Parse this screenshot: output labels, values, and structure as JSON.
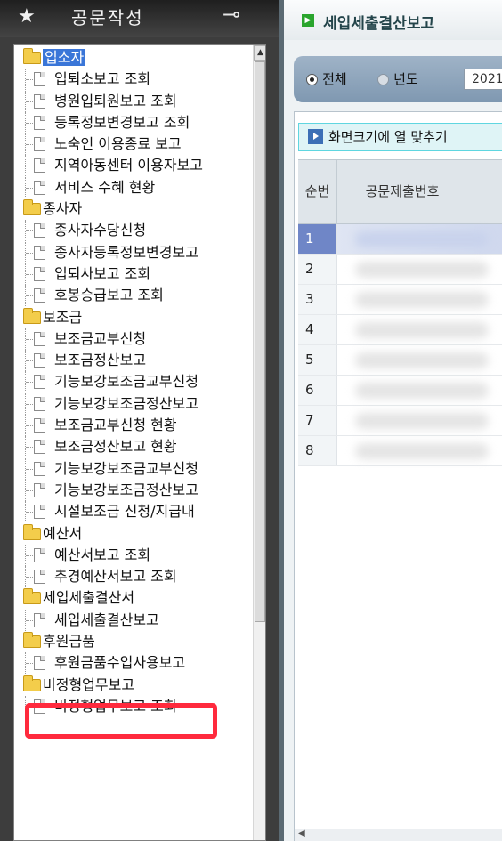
{
  "left_panel": {
    "title": "공문작성",
    "star_icon": "★",
    "pin_icon": "⊸"
  },
  "tree": [
    {
      "type": "folder",
      "label": "입소자",
      "selected": true
    },
    {
      "type": "item",
      "label": "입퇴소보고 조회"
    },
    {
      "type": "item",
      "label": "병원입퇴원보고 조회"
    },
    {
      "type": "item",
      "label": "등록정보변경보고 조회"
    },
    {
      "type": "item",
      "label": "노숙인 이용종료 보고"
    },
    {
      "type": "item",
      "label": "지역아동센터 이용자보고"
    },
    {
      "type": "item",
      "label": "서비스 수혜 현황"
    },
    {
      "type": "folder",
      "label": "종사자"
    },
    {
      "type": "item",
      "label": "종사자수당신청"
    },
    {
      "type": "item",
      "label": "종사자등록정보변경보고"
    },
    {
      "type": "item",
      "label": "입퇴사보고 조회"
    },
    {
      "type": "item",
      "label": "호봉승급보고 조회"
    },
    {
      "type": "folder",
      "label": "보조금"
    },
    {
      "type": "item",
      "label": "보조금교부신청"
    },
    {
      "type": "item",
      "label": "보조금정산보고"
    },
    {
      "type": "item",
      "label": "기능보강보조금교부신청"
    },
    {
      "type": "item",
      "label": "기능보강보조금정산보고"
    },
    {
      "type": "item",
      "label": "보조금교부신청 현황"
    },
    {
      "type": "item",
      "label": "보조금정산보고 현황"
    },
    {
      "type": "item",
      "label": "기능보강보조금교부신청"
    },
    {
      "type": "item",
      "label": "기능보강보조금정산보고"
    },
    {
      "type": "item",
      "label": "시설보조금 신청/지급내"
    },
    {
      "type": "folder",
      "label": "예산서"
    },
    {
      "type": "item",
      "label": "예산서보고 조회"
    },
    {
      "type": "item",
      "label": "추경예산서보고 조회"
    },
    {
      "type": "folder",
      "label": "세입세출결산서"
    },
    {
      "type": "item",
      "label": "세입세출결산보고"
    },
    {
      "type": "folder",
      "label": "후원금품"
    },
    {
      "type": "item",
      "label": "후원금품수입사용보고"
    },
    {
      "type": "folder",
      "label": "비정형업무보고"
    },
    {
      "type": "item",
      "label": "비정형업무보고 조회"
    }
  ],
  "right_panel": {
    "title": "세입세출결산보고",
    "filter": {
      "radio_all": "전체",
      "radio_year": "년도",
      "selected": "전체",
      "year_value": "2021"
    },
    "fit_columns_button": "화면크기에 열 맞추기",
    "grid": {
      "headers": [
        "순번",
        "공문제출번호"
      ],
      "rows": [
        "1",
        "2",
        "3",
        "4",
        "5",
        "6",
        "7",
        "8"
      ],
      "selected_row": "1"
    }
  },
  "colors": {
    "highlight": "#ff2a3d",
    "selected_tree_item": "#3a76d8",
    "selected_grid_row": "#6f86c7"
  }
}
